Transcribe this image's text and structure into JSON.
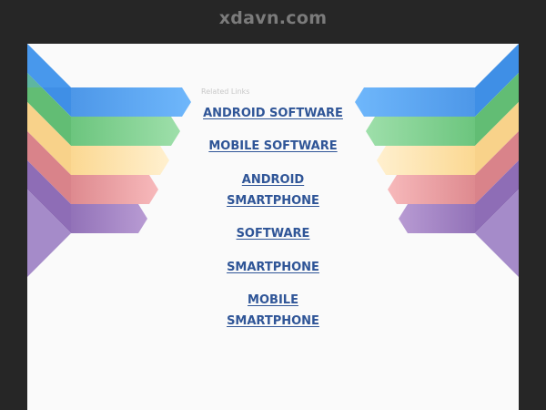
{
  "site": {
    "title": "xdavn.com"
  },
  "related": {
    "heading": "Related Links"
  },
  "links": [
    {
      "line1": "ANDROID SOFTWARE",
      "line2": ""
    },
    {
      "line1": "MOBILE SOFTWARE",
      "line2": ""
    },
    {
      "line1": "ANDROID",
      "line2": "SMARTPHONE"
    },
    {
      "line1": "SOFTWARE",
      "line2": ""
    },
    {
      "line1": "SMARTPHONE",
      "line2": ""
    },
    {
      "line1": "MOBILE",
      "line2": "SMARTPHONE"
    }
  ],
  "colors": {
    "background": "#262626",
    "panel": "#fafafa",
    "link": "#2f5597",
    "ribbons": [
      "#5aa8f5",
      "#7fd08e",
      "#fde1a6",
      "#e89a9e",
      "#a07cc1"
    ]
  }
}
